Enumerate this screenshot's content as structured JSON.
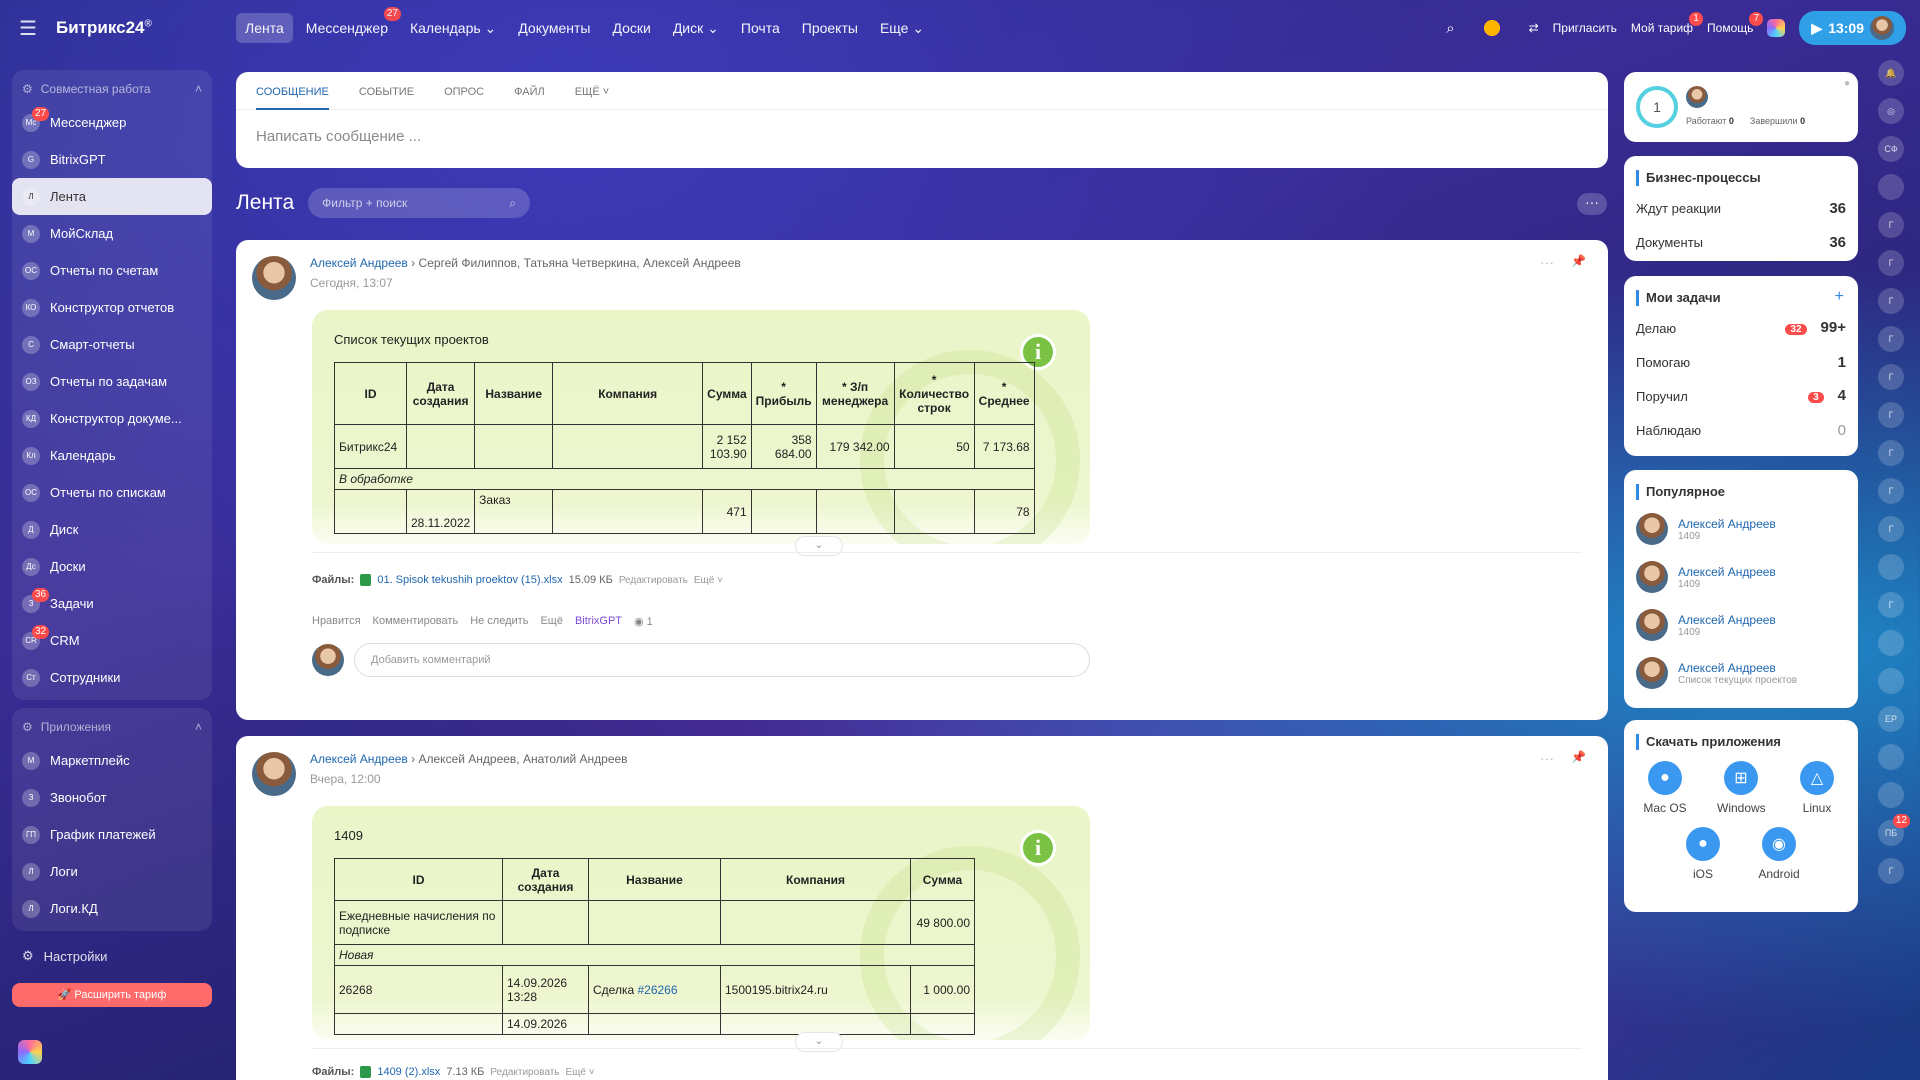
{
  "app": {
    "title": "Битрикс24",
    "reg": "®"
  },
  "topnav": [
    {
      "label": "Лента",
      "active": true
    },
    {
      "label": "Мессенджер",
      "badge": "27"
    },
    {
      "label": "Календарь ⌄"
    },
    {
      "label": "Документы"
    },
    {
      "label": "Доски"
    },
    {
      "label": "Диск ⌄"
    },
    {
      "label": "Почта"
    },
    {
      "label": "Проекты"
    },
    {
      "label": "Еще ⌄"
    }
  ],
  "topright": {
    "invite": "Пригласить",
    "tariff": "Мой тариф",
    "tariff_badge": "1",
    "help": "Помощь",
    "help_badge": "7",
    "time": "13:09"
  },
  "sidebar": {
    "group1": "Совместная работа",
    "items1": [
      {
        "label": "Мессенджер",
        "icon": "Мс",
        "badge": "27"
      },
      {
        "label": "BitrixGPT",
        "icon": "G"
      },
      {
        "label": "Лента",
        "icon": "Л",
        "active": true
      },
      {
        "label": "МойСклад",
        "icon": "М"
      },
      {
        "label": "Отчеты по счетам",
        "icon": "ОС"
      },
      {
        "label": "Конструктор отчетов",
        "icon": "КО"
      },
      {
        "label": "Смарт-отчеты",
        "icon": "С"
      },
      {
        "label": "Отчеты по задачам",
        "icon": "ОЗ"
      },
      {
        "label": "Конструктор докуме...",
        "icon": "КД"
      },
      {
        "label": "Календарь",
        "icon": "Кл"
      },
      {
        "label": "Отчеты по спискам",
        "icon": "ОС"
      },
      {
        "label": "Диск",
        "icon": "Д"
      },
      {
        "label": "Доски",
        "icon": "Дс"
      },
      {
        "label": "Задачи",
        "icon": "З",
        "badge": "36"
      },
      {
        "label": "CRM",
        "icon": "CR",
        "badge": "32"
      },
      {
        "label": "Сотрудники",
        "icon": "Ст"
      }
    ],
    "group2": "Приложения",
    "items2": [
      {
        "label": "Маркетплейс",
        "icon": "М"
      },
      {
        "label": "Звонобот",
        "icon": "З"
      },
      {
        "label": "График платежей",
        "icon": "ГП"
      },
      {
        "label": "Логи",
        "icon": "Л"
      },
      {
        "label": "Логи.КД",
        "icon": "Л"
      }
    ],
    "settings": "Настройки",
    "upgrade": "Расширить тариф"
  },
  "composer": {
    "tabs": [
      "СООБЩЕНИЕ",
      "СОБЫТИЕ",
      "ОПРОС",
      "ФАЙЛ",
      "ЕЩЁ ˅"
    ],
    "placeholder": "Написать сообщение ..."
  },
  "feed": {
    "title": "Лента",
    "filter_placeholder": "Фильтр + поиск"
  },
  "posts": [
    {
      "author": "Алексей Андреев",
      "recipients": "Сергей Филиппов, Татьяна Четверкина, Алексей Андреев",
      "time": "Сегодня, 13:07",
      "card_title": "Список текущих проектов",
      "headers": [
        "ID",
        "Дата создания",
        "Название",
        "Компания",
        "Сумма",
        "* Прибыль",
        "* З/п менеджера",
        "* Количество строк",
        "* Среднее"
      ],
      "row1": [
        "Битрикс24",
        "",
        "",
        "",
        "2 152 103.90",
        "358 684.00",
        "179 342.00",
        "50",
        "7 173.68"
      ],
      "group": "В обработке",
      "row2": [
        "",
        "28.11.2022",
        "Заказ",
        "",
        "471",
        "",
        "",
        "",
        "78"
      ],
      "files_label": "Файлы:",
      "file_name": "01. Spisok tekushih proektov (15).xlsx",
      "file_size": "15.09 КБ",
      "file_edit": "Редактировать",
      "file_more": "Ещё ˅",
      "actions": [
        "Нравится",
        "Комментировать",
        "Не следить",
        "Ещё",
        "BitrixGPT"
      ],
      "views": "1",
      "comment_placeholder": "Добавить комментарий"
    },
    {
      "author": "Алексей Андреев",
      "recipients": "Алексей Андреев, Анатолий Андреев",
      "time": "Вчера, 12:00",
      "card_title": "1409",
      "headers": [
        "ID",
        "Дата создания",
        "Название",
        "Компания",
        "Сумма"
      ],
      "row1": [
        "Ежедневные начисления по подписке",
        "",
        "",
        "",
        "49 800.00"
      ],
      "group": "Новая",
      "row2": [
        "26268",
        "14.09.2026 13:28",
        "Сделка ",
        "1500195.bitrix24.ru",
        "1 000.00"
      ],
      "row2_link": "#26266",
      "row3_date": "14.09.2026",
      "files_label": "Файлы:",
      "file_name": "1409 (2).xlsx",
      "file_size": "7.13 КБ",
      "file_edit": "Редактировать",
      "file_more": "Ещё ˅"
    }
  ],
  "right": {
    "status": {
      "count": "1",
      "working_label": "Работают",
      "working": "0",
      "done_label": "Завершили",
      "done": "0"
    },
    "bp": {
      "title": "Бизнес-процессы",
      "rows": [
        {
          "label": "Ждут реакции",
          "value": "36"
        },
        {
          "label": "Документы",
          "value": "36"
        }
      ]
    },
    "tasks": {
      "title": "Мои задачи",
      "rows": [
        {
          "label": "Делаю",
          "badge": "32",
          "value": "99+"
        },
        {
          "label": "Помогаю",
          "value": "1"
        },
        {
          "label": "Поручил",
          "badge": "3",
          "value": "4"
        },
        {
          "label": "Наблюдаю",
          "value": "0"
        }
      ]
    },
    "popular": {
      "title": "Популярное",
      "items": [
        {
          "name": "Алексей Андреев",
          "sub": "1409"
        },
        {
          "name": "Алексей Андреев",
          "sub": "1409"
        },
        {
          "name": "Алексей Андреев",
          "sub": "1409"
        },
        {
          "name": "Алексей Андреев",
          "sub": "Список текущих проектов"
        }
      ]
    },
    "apps": {
      "title": "Скачать приложения",
      "items": [
        "Mac OS",
        "Windows",
        "Linux",
        "iOS",
        "Android"
      ]
    }
  },
  "rail": [
    "СФ",
    "",
    "Г",
    "Г",
    "Г",
    "Г",
    "Г",
    "Г",
    "Г",
    "Г",
    "Г",
    "",
    "Г",
    "",
    "",
    "ЕР",
    "",
    "",
    "ПБ",
    "Г"
  ],
  "rail_badge": "12",
  "colors": {
    "accent": "#2067b0",
    "card": "#eaf5c8",
    "badge": "#ff4b4b",
    "info": "#7bc244"
  }
}
